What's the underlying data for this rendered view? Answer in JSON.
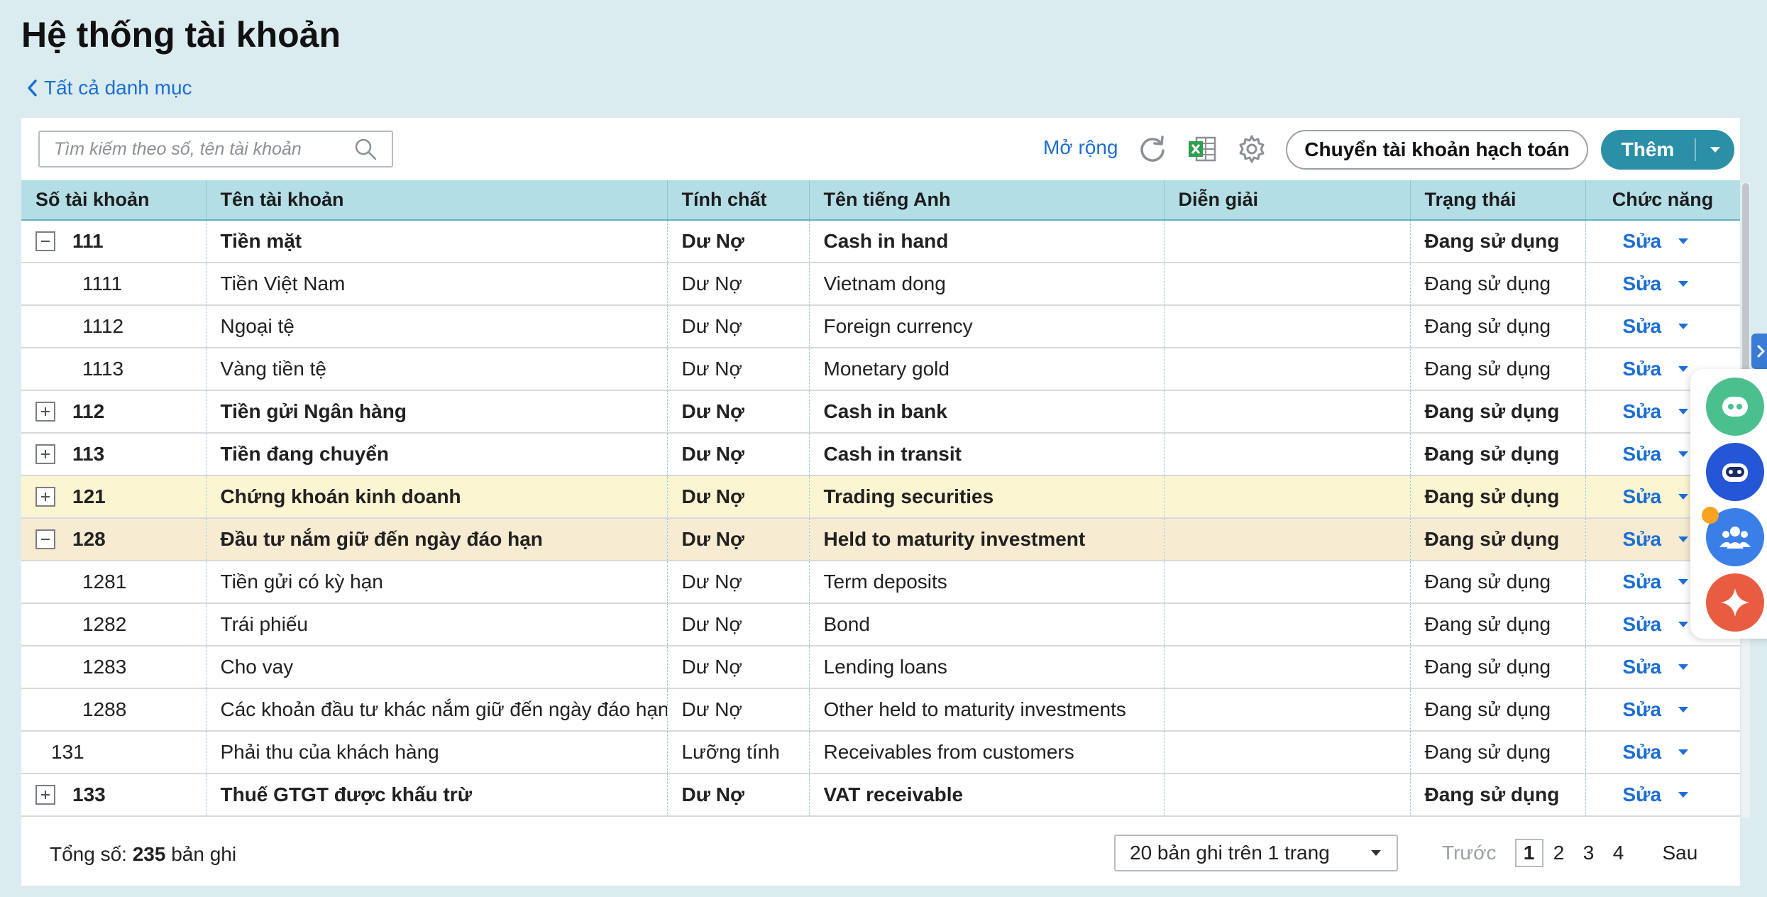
{
  "page": {
    "title": "Hệ thống tài khoản",
    "back_label": "Tất cả danh mục"
  },
  "toolbar": {
    "search_placeholder": "Tìm kiếm theo số, tên tài khoản",
    "expand_label": "Mở rộng",
    "transfer_label": "Chuyển tài khoản hạch toán",
    "add_label": "Thêm"
  },
  "table": {
    "columns": [
      "Số tài khoản",
      "Tên tài khoản",
      "Tính chất",
      "Tên tiếng Anh",
      "Diễn giải",
      "Trạng thái",
      "Chức năng"
    ],
    "edit_label": "Sửa",
    "rows": [
      {
        "number": "111",
        "name": "Tiền mặt",
        "nature": "Dư Nợ",
        "english": "Cash in hand",
        "note": "",
        "status": "Đang sử dụng"
      },
      {
        "number": "1111",
        "name": "Tiền Việt Nam",
        "nature": "Dư Nợ",
        "english": "Vietnam dong",
        "note": "",
        "status": "Đang sử dụng"
      },
      {
        "number": "1112",
        "name": "Ngoại tệ",
        "nature": "Dư Nợ",
        "english": "Foreign currency",
        "note": "",
        "status": "Đang sử dụng"
      },
      {
        "number": "1113",
        "name": "Vàng tiền tệ",
        "nature": "Dư Nợ",
        "english": "Monetary gold",
        "note": "",
        "status": "Đang sử dụng"
      },
      {
        "number": "112",
        "name": "Tiền gửi Ngân hàng",
        "nature": "Dư Nợ",
        "english": "Cash in bank",
        "note": "",
        "status": "Đang sử dụng"
      },
      {
        "number": "113",
        "name": "Tiền đang chuyển",
        "nature": "Dư Nợ",
        "english": "Cash in transit",
        "note": "",
        "status": "Đang sử dụng"
      },
      {
        "number": "121",
        "name": "Chứng khoán kinh doanh",
        "nature": "Dư Nợ",
        "english": "Trading securities",
        "note": "",
        "status": "Đang sử dụng"
      },
      {
        "number": "128",
        "name": "Đầu tư nắm giữ đến ngày đáo hạn",
        "nature": "Dư Nợ",
        "english": "Held to maturity investment",
        "note": "",
        "status": "Đang sử dụng"
      },
      {
        "number": "1281",
        "name": "Tiền gửi có kỳ hạn",
        "nature": "Dư Nợ",
        "english": "Term deposits",
        "note": "",
        "status": "Đang sử dụng"
      },
      {
        "number": "1282",
        "name": "Trái phiếu",
        "nature": "Dư Nợ",
        "english": "Bond",
        "note": "",
        "status": "Đang sử dụng"
      },
      {
        "number": "1283",
        "name": "Cho vay",
        "nature": "Dư Nợ",
        "english": "Lending loans",
        "note": "",
        "status": "Đang sử dụng"
      },
      {
        "number": "1288",
        "name": "Các khoản đầu tư khác nắm giữ đến ngày đáo hạn",
        "nature": "Dư Nợ",
        "english": "Other held to maturity investments",
        "note": "",
        "status": "Đang sử dụng"
      },
      {
        "number": "131",
        "name": "Phải thu của khách hàng",
        "nature": "Lưỡng tính",
        "english": "Receivables from customers",
        "note": "",
        "status": "Đang sử dụng"
      },
      {
        "number": "133",
        "name": "Thuế GTGT được khấu trừ",
        "nature": "Dư Nợ",
        "english": "VAT receivable",
        "note": "",
        "status": "Đang sử dụng"
      }
    ]
  },
  "footer": {
    "total_prefix": "Tổng số:",
    "total_count": "235",
    "total_suffix": "bản ghi",
    "page_size_label": "20 bản ghi trên 1 trang",
    "prev_label": "Trước",
    "pages": [
      "1",
      "2",
      "3",
      "4"
    ],
    "current_page": "1",
    "next_label": "Sau"
  },
  "colors": {
    "background": "#daecf0",
    "header": "#b4dee6",
    "accent": "#2b8fa7",
    "link": "#1b6ed4",
    "row_highlight_yellow": "#fcf5d2",
    "row_highlight_tan": "#f7ebd1"
  }
}
